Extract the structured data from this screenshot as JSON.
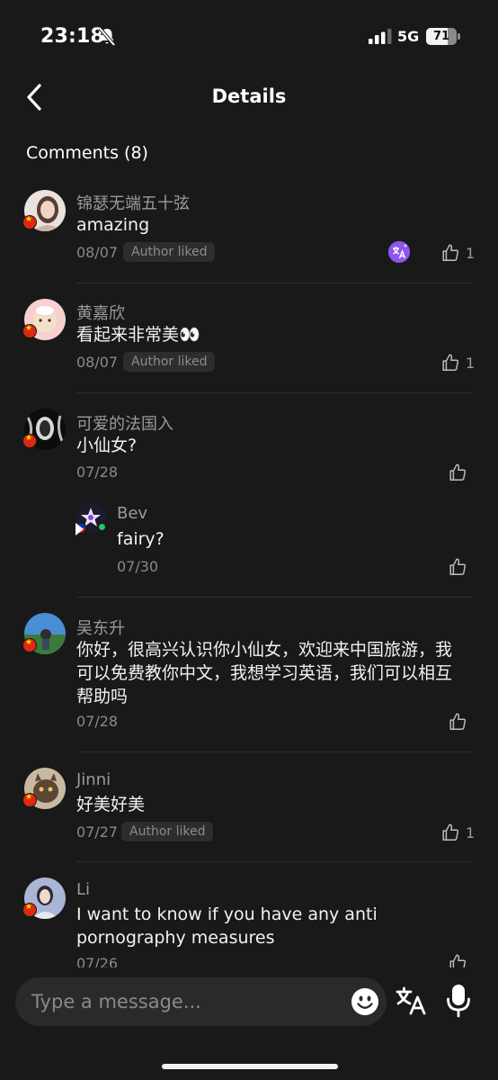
{
  "status_bar": {
    "time": "23:18",
    "network": "5G",
    "battery": "71",
    "battery_level": 0.71
  },
  "header": {
    "title": "Details"
  },
  "comments_heading": "Comments (8)",
  "badges": {
    "author_liked": "Author liked"
  },
  "comments": [
    {
      "username": "锦瑟无端五十弦",
      "text": "amazing",
      "date": "08/07",
      "likes": "1"
    },
    {
      "username": "黄嘉欣",
      "text": "看起来非常美👀",
      "date": "08/07",
      "likes": "1"
    },
    {
      "username": "可爱的法国入",
      "text": "小仙女?",
      "date": "07/28",
      "likes": ""
    },
    {
      "username": "Bev",
      "text": "fairy?",
      "date": "07/30",
      "likes": ""
    },
    {
      "username": "吴东升",
      "text": "你好，很高兴认识你小仙女，欢迎来中国旅游，我可以免费教你中文，我想学习英语，我们可以相互帮助吗",
      "date": "07/28",
      "likes": ""
    },
    {
      "username": "Jinni",
      "text": "好美好美",
      "date": "07/27",
      "likes": "1"
    },
    {
      "username": "Li",
      "text": "I want to know if you have any anti pornography measures",
      "date": "07/26",
      "likes": ""
    }
  ],
  "input": {
    "placeholder": "Type a message..."
  },
  "icons": {
    "back": "chevron-left-icon",
    "like": "thumbs-up-icon",
    "translate": "translate-icon",
    "emoji": "smiley-icon",
    "mic": "microphone-icon",
    "bell_muted": "bell-slash-icon"
  },
  "colors": {
    "background": "#191919",
    "accent": "#8e55f0",
    "text_primary": "#f2f2f2",
    "text_secondary": "#8a8a8a",
    "online": "#22c55e"
  }
}
